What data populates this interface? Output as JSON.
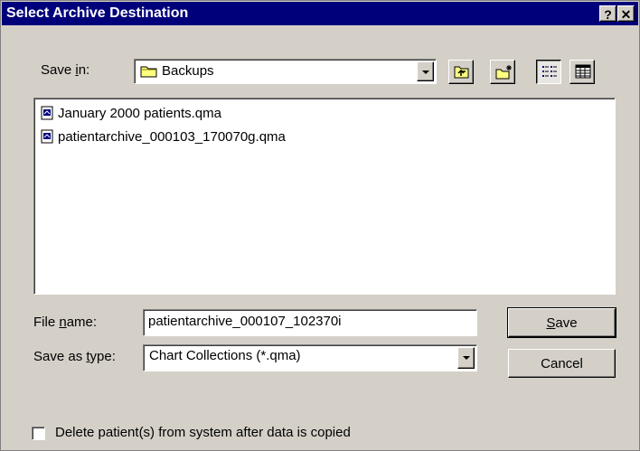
{
  "window": {
    "title": "Select Archive Destination",
    "help_label": "?",
    "close_label": "✕"
  },
  "save_in": {
    "label_prefix": "Save ",
    "label_accel": "i",
    "label_suffix": "n:",
    "value": "Backups"
  },
  "toolbar": {
    "buttons": [
      "up-one-level",
      "create-new-folder",
      "list-view",
      "details-view"
    ],
    "active_view": "list-view"
  },
  "files": [
    {
      "name": "January 2000 patients.qma",
      "icon": "qma-file-icon"
    },
    {
      "name": "patientarchive_000103_170070g.qma",
      "icon": "qma-file-icon"
    }
  ],
  "file_name": {
    "label_prefix": "File ",
    "label_accel": "n",
    "label_suffix": "ame:",
    "value": "patientarchive_000107_102370i"
  },
  "save_as_type": {
    "label_prefix": "Save as ",
    "label_accel": "t",
    "label_suffix": "ype:",
    "value": "Chart Collections (*.qma)"
  },
  "buttons": {
    "save_accel": "S",
    "save_rest": "ave",
    "cancel": "Cancel"
  },
  "delete_option": {
    "label": "Delete patient(s) from system after data is copied",
    "checked": false
  },
  "colors": {
    "titlebar": "#00007b",
    "face": "#d4d0c8"
  }
}
